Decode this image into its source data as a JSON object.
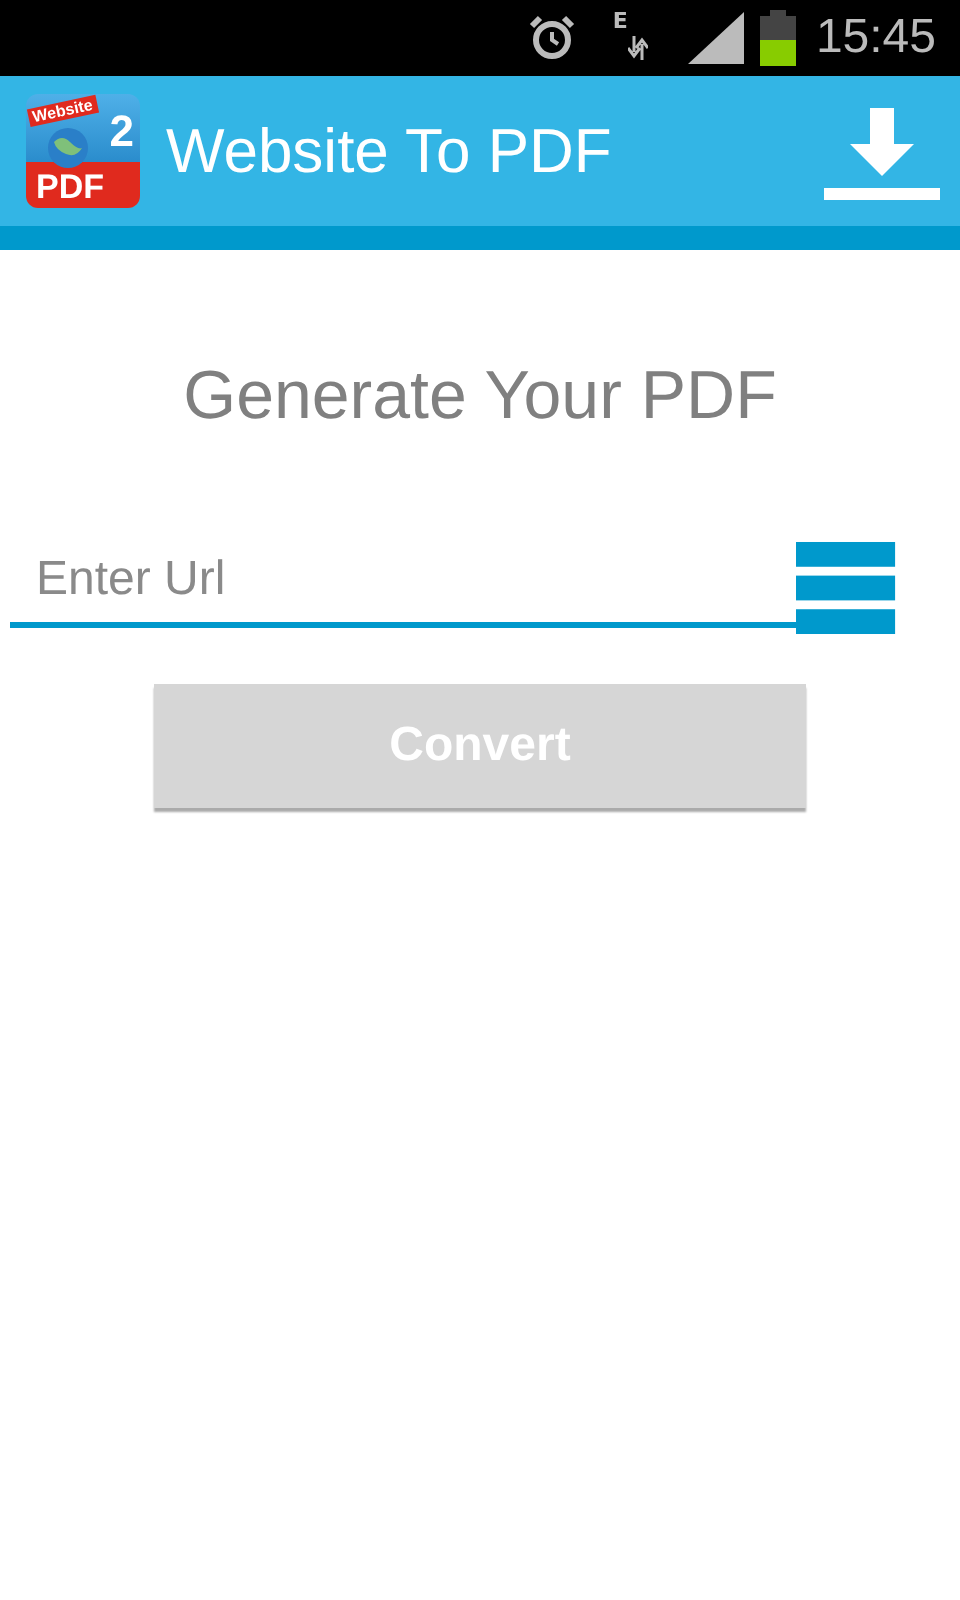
{
  "status_bar": {
    "network": "E",
    "time": "15:45"
  },
  "app_bar": {
    "logo": {
      "top": "Website",
      "digit": "2",
      "bottom": "PDF"
    },
    "title": "Website To PDF"
  },
  "heading": "Generate Your PDF",
  "url_field": {
    "placeholder": "Enter Url"
  },
  "convert_button": {
    "label": "Convert",
    "disabled": true
  }
}
